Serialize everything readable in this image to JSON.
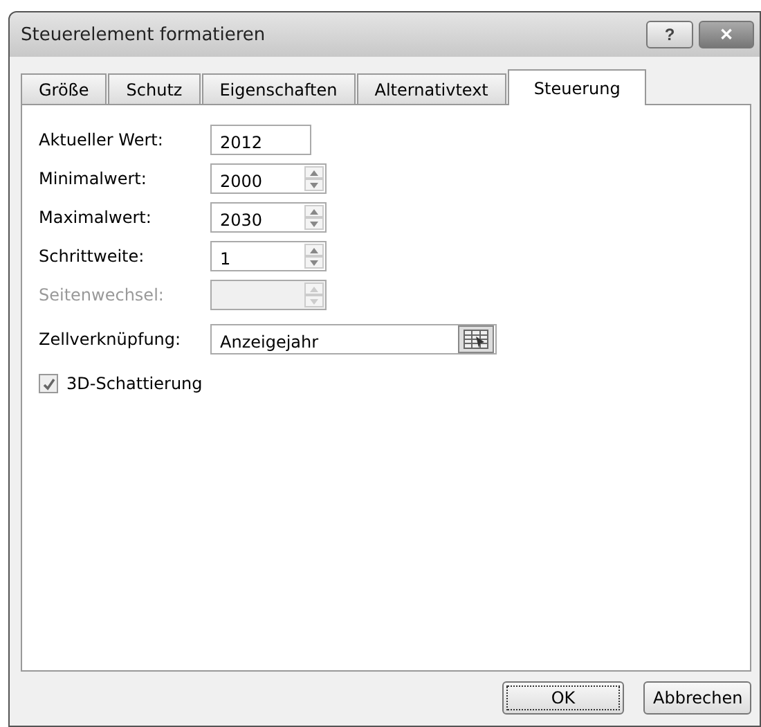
{
  "window": {
    "title": "Steuerelement formatieren",
    "help": "?",
    "close": "✕"
  },
  "tabs": [
    {
      "label": "Größe",
      "selected": false
    },
    {
      "label": "Schutz",
      "selected": false
    },
    {
      "label": "Eigenschaften",
      "selected": false
    },
    {
      "label": "Alternativtext",
      "selected": false
    },
    {
      "label": "Steuerung",
      "selected": true
    }
  ],
  "fields": [
    {
      "kind": "text",
      "label": "Aktueller Wert:",
      "value": "2012",
      "disabled": false
    },
    {
      "kind": "spin",
      "label": "Minimalwert:",
      "value": "2000",
      "disabled": false
    },
    {
      "kind": "spin",
      "label": "Maximalwert:",
      "value": "2030",
      "disabled": false
    },
    {
      "kind": "spin",
      "label": "Schrittweite:",
      "value": "1",
      "disabled": false
    },
    {
      "kind": "spin",
      "label": "Seitenwechsel:",
      "disabled": true
    },
    {
      "kind": "ref",
      "label": "Zellverknüpfung:",
      "value": "Anzeigejahr",
      "disabled": false
    }
  ],
  "checkbox": {
    "label": "3D-Schattierung",
    "checked": true
  },
  "buttons": [
    {
      "label": "OK",
      "default": true
    },
    {
      "label": "Abbrechen",
      "default": false
    }
  ]
}
